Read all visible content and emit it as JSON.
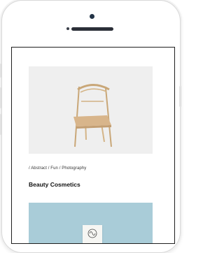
{
  "portfolio": {
    "meta": "/ Abstract / Fun / Photography",
    "title": "Beauty Cosmetics"
  },
  "colors": {
    "hero_bg": "#efefef",
    "thumb_bg": "#a9ccd8",
    "screen_border": "#1f1f1f"
  }
}
